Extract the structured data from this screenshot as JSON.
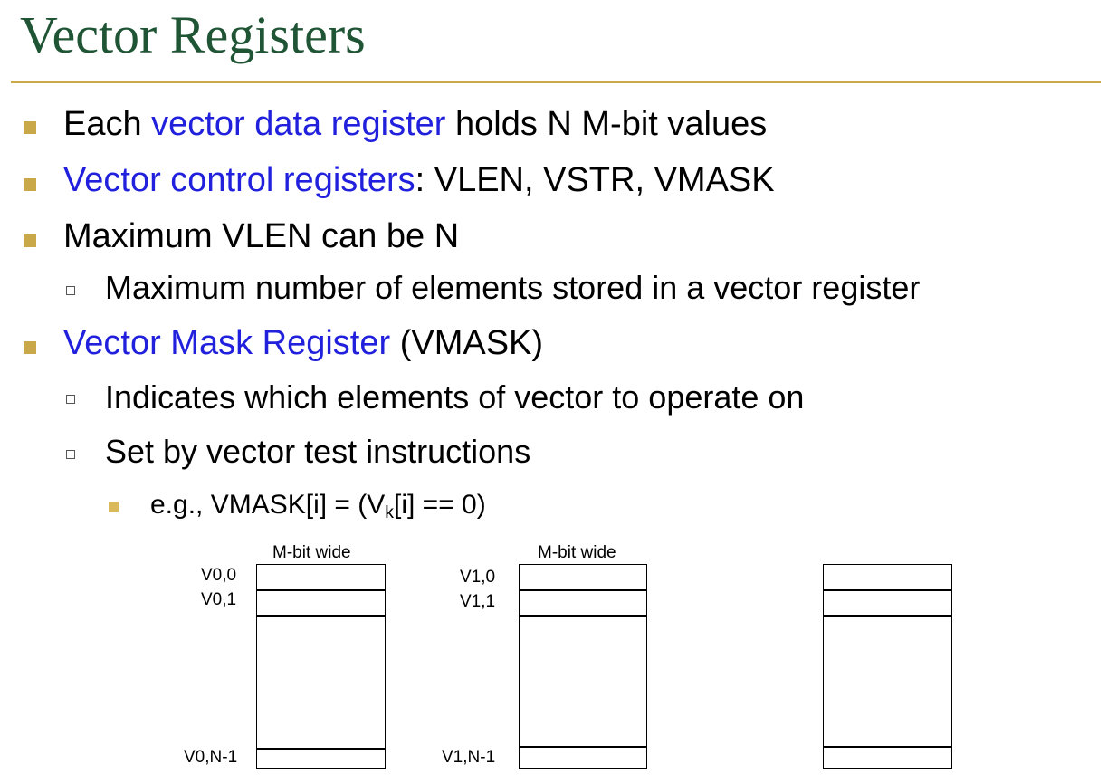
{
  "slide": {
    "title": "Vector Registers",
    "bullets": {
      "b1": {
        "hl": "vector data register",
        "pre": "Each ",
        "post": " holds N M-bit values"
      },
      "b2": {
        "hl": "Vector control registers",
        "post": ": VLEN, VSTR, VMASK"
      },
      "b3": {
        "text": "Maximum VLEN can be N",
        "sub1": "Maximum number of elements stored in a vector register"
      },
      "b4": {
        "hl": "Vector Mask Register",
        "post": " (VMASK)",
        "sub1": "Indicates which elements of vector to operate on",
        "sub2": "Set by vector test instructions",
        "example": {
          "pre": "e.g., VMASK[i] = (V",
          "sub": "k",
          "post": "[i] == 0)"
        }
      }
    },
    "colors": {
      "title": "#1f5535",
      "accent": "#c9a84a",
      "highlight": "#2020dd"
    }
  },
  "diagram": {
    "registers": [
      {
        "header": "M-bit wide",
        "top": "V0,0",
        "second": "V0,1",
        "last": "V0,N-1"
      },
      {
        "header": "M-bit wide",
        "top": "V1,0",
        "second": "V1,1",
        "last": "V1,N-1"
      },
      {
        "header": "",
        "top": "",
        "second": "",
        "last": ""
      }
    ]
  }
}
